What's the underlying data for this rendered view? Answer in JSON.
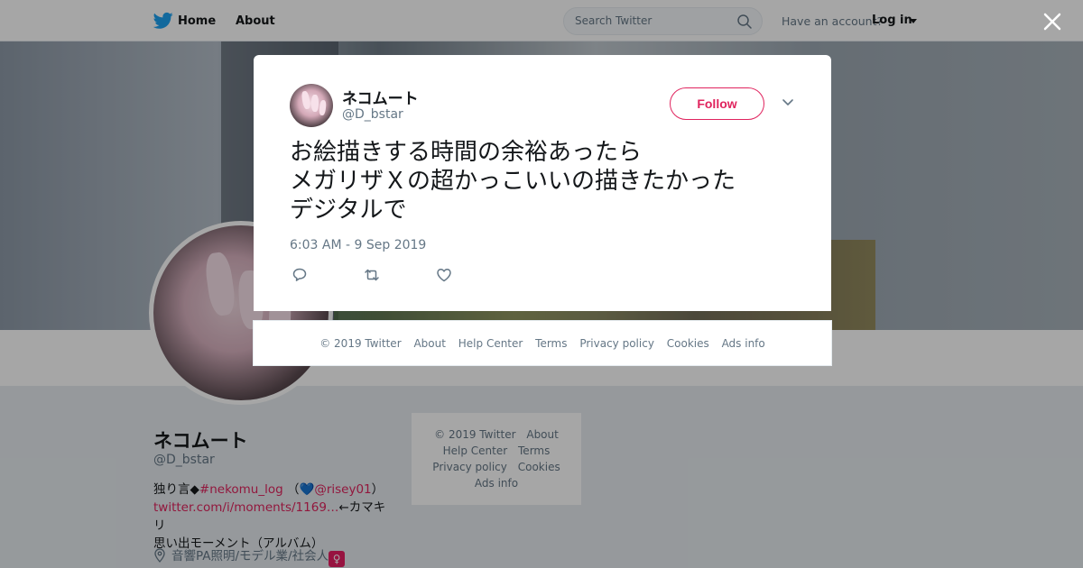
{
  "nav": {
    "home_label": "Home",
    "about_label": "About",
    "search_placeholder": "Search Twitter",
    "have_account": "Have an account?",
    "login_label": "Log in"
  },
  "profile": {
    "name": "ネコムート",
    "handle": "@D_bstar",
    "bio_line1_prefix": "独り言◆",
    "bio_hashtag": "#nekomu_log",
    "bio_paren_open": "（",
    "bio_heart": "💙",
    "bio_mention": "@risey01",
    "bio_paren_close": "）",
    "bio_link": "twitter.com/i/moments/1169…",
    "bio_link_suffix": "←カマキリ",
    "bio_line3": "思い出モーメント（アルバム）",
    "location": "音響PA照明/モデル業/社会人",
    "location_badge": "♀"
  },
  "side_footer": {
    "copyright": "© 2019 Twitter",
    "about": "About",
    "help": "Help Center",
    "terms": "Terms",
    "privacy": "Privacy policy",
    "cookies": "Cookies",
    "ads": "Ads info"
  },
  "tweet": {
    "author_name": "ネコムート",
    "author_handle": "@D_bstar",
    "follow_label": "Follow",
    "text_line1": "お絵描きする時間の余裕あったら",
    "text_line2": "メガリザＸの超かっこいいの描きたかった",
    "text_line3": "デジタルで",
    "timestamp": "6:03 AM - 9 Sep 2019"
  },
  "modal_footer": {
    "copyright": "© 2019 Twitter",
    "about": "About",
    "help": "Help Center",
    "terms": "Terms",
    "privacy": "Privacy policy",
    "cookies": "Cookies",
    "ads": "Ads info"
  },
  "colors": {
    "accent": "#e0245e",
    "brand_blue": "#1da1f2",
    "text_secondary": "#657786"
  }
}
